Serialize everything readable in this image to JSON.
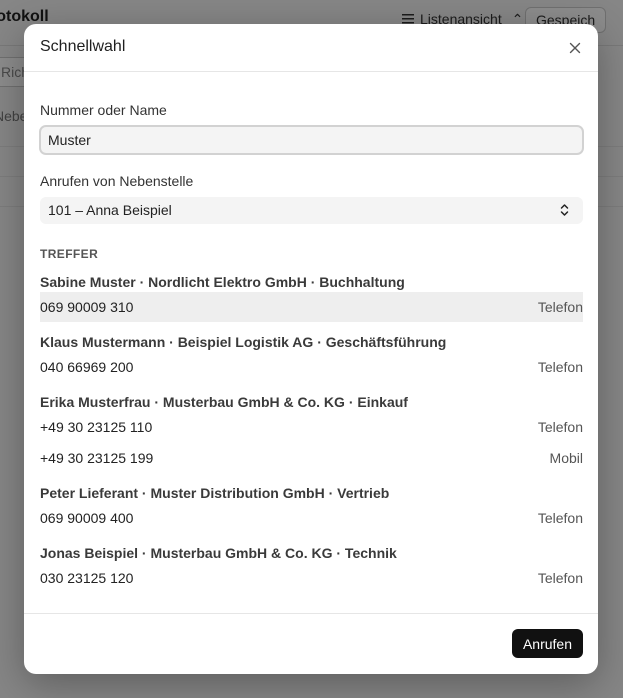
{
  "background": {
    "title": "rotokoll",
    "listview_label": "Listenansicht",
    "listview_chevron": "⌃",
    "spoken_label": "Gespeich",
    "input_placeholder": "Rich",
    "label2": "Nebe"
  },
  "dialog": {
    "title": "Schnellwahl",
    "close_icon": "close-icon",
    "search": {
      "label": "Nummer oder Name",
      "value": "Muster"
    },
    "extension": {
      "label": "Anrufen von Nebenstelle",
      "value": "101 – Anna Beispiel"
    },
    "results_label": "TREFFER",
    "contacts": [
      {
        "title": "Sabine Muster · Nordlicht Elektro GmbH · Buchhaltung",
        "numbers": [
          {
            "number": "069 90009 310",
            "type": "Telefon",
            "highlighted": true
          }
        ]
      },
      {
        "title": "Klaus Mustermann · Beispiel Logistik AG · Geschäftsführung",
        "numbers": [
          {
            "number": "040 66969 200",
            "type": "Telefon"
          }
        ]
      },
      {
        "title": "Erika Musterfrau · Musterbau GmbH & Co. KG · Einkauf",
        "numbers": [
          {
            "number": "+49 30 23125 110",
            "type": "Telefon"
          },
          {
            "number": "+49 30 23125 199",
            "type": "Mobil"
          }
        ]
      },
      {
        "title": "Peter Lieferant · Muster Distribution GmbH · Vertrieb",
        "numbers": [
          {
            "number": "069 90009 400",
            "type": "Telefon"
          }
        ]
      },
      {
        "title": "Jonas Beispiel · Musterbau GmbH & Co. KG · Technik",
        "numbers": [
          {
            "number": "030 23125 120",
            "type": "Telefon"
          }
        ]
      }
    ],
    "call_button": "Anrufen"
  },
  "colors": {
    "overlay": "#000000",
    "primary_button": "#111111",
    "highlight_row": "#eeeeee"
  }
}
